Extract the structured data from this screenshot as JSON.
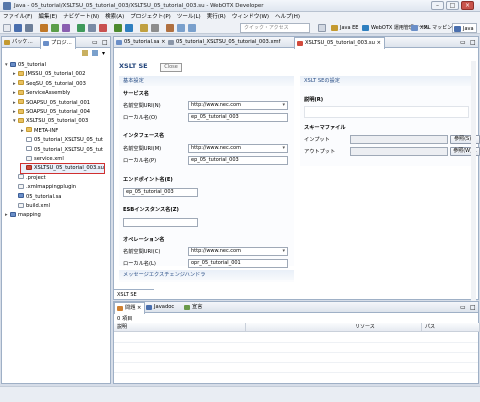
{
  "window": {
    "title": "Java - 05_tutorial/XSLTSU_05_tutorial_003/XSLTSU_05_tutorial_003.su - WebOTX Developer"
  },
  "menu": [
    "ファイル(F)",
    "編集(E)",
    "ナビゲート(N)",
    "検索(A)",
    "プロジェクト(P)",
    "ツール(L)",
    "実行(R)",
    "ウィンドウ(W)",
    "ヘルプ(H)"
  ],
  "toolbar": {
    "quick_access_placeholder": "クイック・アクセス",
    "perspectives": [
      "Java EE",
      "WebOTX 運用管理ツール",
      "XML マッピング",
      "Java"
    ]
  },
  "left_tabs": [
    "パッケ…",
    "プロジ…"
  ],
  "tree": [
    {
      "label": "05_tutorial",
      "icon": "proj",
      "indent": 0,
      "tw": "▾"
    },
    {
      "label": "JMSSU_05_tutorial_002",
      "icon": "folder",
      "indent": 1,
      "tw": "▸"
    },
    {
      "label": "SeqSU_05_tutorial_003",
      "icon": "folder",
      "indent": 1,
      "tw": "▸"
    },
    {
      "label": "ServiceAssembly",
      "icon": "folder",
      "indent": 1,
      "tw": "▸"
    },
    {
      "label": "SOAPSU_05_tutorial_001",
      "icon": "folder",
      "indent": 1,
      "tw": "▸"
    },
    {
      "label": "SOAPSU_05_tutorial_004",
      "icon": "folder",
      "indent": 1,
      "tw": "▸"
    },
    {
      "label": "XSLTSU_05_tutorial_003",
      "icon": "folder",
      "indent": 1,
      "tw": "▾"
    },
    {
      "label": "META-INF",
      "icon": "folder",
      "indent": 2,
      "tw": "▸"
    },
    {
      "label": "05_tutorial_XSLTSU_05_tut",
      "icon": "file",
      "indent": 2,
      "tw": ""
    },
    {
      "label": "05_tutorial_XSLTSU_05_tut",
      "icon": "file",
      "indent": 2,
      "tw": ""
    },
    {
      "label": "service.xml",
      "icon": "xml",
      "indent": 2,
      "tw": ""
    },
    {
      "label": "XSLTSU_05_tutorial_003.su",
      "icon": "xsl",
      "indent": 2,
      "tw": "",
      "selected": true
    },
    {
      "label": ".project",
      "icon": "xml",
      "indent": 1,
      "tw": ""
    },
    {
      "label": ".xmlmappingplugin",
      "icon": "xml",
      "indent": 1,
      "tw": ""
    },
    {
      "label": "05_tutorial.sa",
      "icon": "proj",
      "indent": 1,
      "tw": ""
    },
    {
      "label": "build.xml",
      "icon": "xml",
      "indent": 1,
      "tw": ""
    },
    {
      "label": "mapping",
      "icon": "proj",
      "indent": 0,
      "tw": "▸"
    }
  ],
  "editor_tabs": [
    "05_tutorial.sa",
    "05_tutorial_XSLTSU_05_tutorial_003.xmf",
    "XSLTSU_05_tutorial_003.su"
  ],
  "form": {
    "title": "XSLT SE",
    "tooltip": "Close",
    "basic": {
      "header": "基本設定",
      "service_section": "サービス名",
      "service_ns_label": "名前空間URI(N)",
      "service_ns_value": "http://www.nec.com",
      "service_local_label": "ローカル名(O)",
      "service_local_value": "ep_05_tutorial_003",
      "interface_section": "インタフェース名",
      "iface_ns_label": "名前空間URI(M)",
      "iface_ns_value": "http://www.nec.com",
      "iface_local_label": "ローカル名(P)",
      "iface_local_value": "ep_05_tutorial_003",
      "endpoint_label": "エンドポイント名(E)",
      "endpoint_value": "ep_05_tutorial_003",
      "esb_label": "ESBインスタンス名(Z)",
      "esb_value": "",
      "operation_section": "オペレーション名",
      "op_ns_label": "名前空間URI(C)",
      "op_ns_value": "http://www.nec.com",
      "op_local_label": "ローカル名(L)",
      "op_local_value": "opr_05_tutorial_001"
    },
    "exchange_header": "メッセージエクスチェンジハンドラ",
    "xslt": {
      "header": "XSLT SEの設定",
      "desc_label": "説明(R)",
      "schema_label": "スキーマファイル",
      "input_label": "インプット",
      "output_label": "アウトプット",
      "browse1": "参照(S)...",
      "browse2": "参照(W)..."
    },
    "bottom_tab": "XSLT SE"
  },
  "bottom": {
    "tabs": [
      "問題",
      "Javadoc",
      "宣言"
    ],
    "count": "0 項目",
    "columns": [
      "説明",
      "リソース",
      "パス"
    ]
  }
}
